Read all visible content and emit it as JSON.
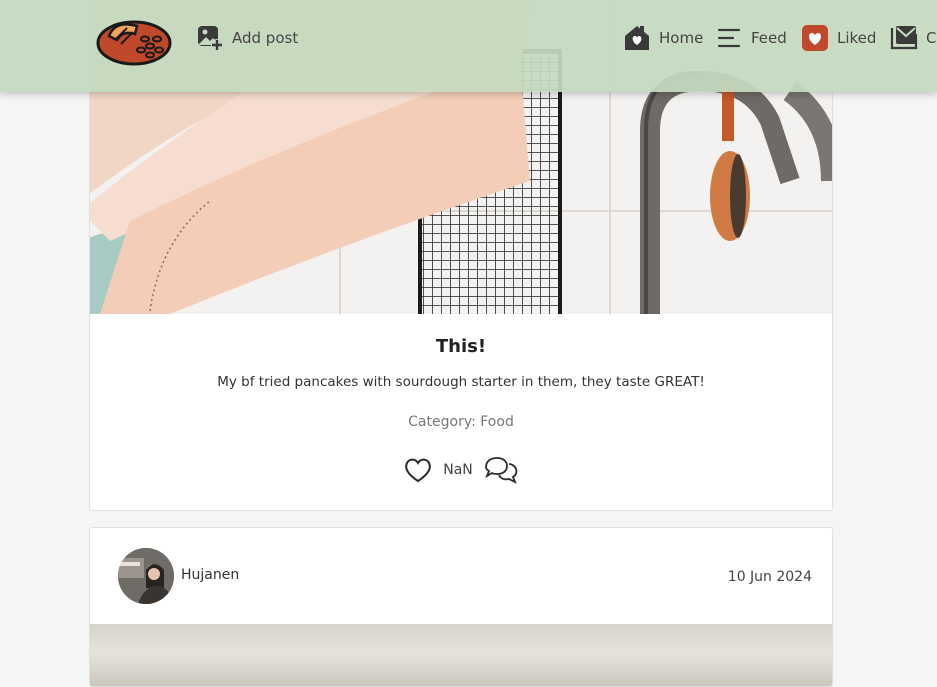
{
  "nav": {
    "add_post": "Add post",
    "home": "Home",
    "feed": "Feed",
    "liked": "Liked",
    "contact": "Co"
  },
  "posts": [
    {
      "title": "This!",
      "text": "My bf tried pancakes with sourdough starter in them, they taste GREAT!",
      "category": "Category: Food",
      "likes": "NaN"
    },
    {
      "author": "Hujanen",
      "date": "10 Jun 2024"
    }
  ],
  "colors": {
    "navbar": "#c4dac0",
    "accent": "#c0492b",
    "icon": "#3a3a3a"
  },
  "icons": [
    "bread-logo",
    "add-image-icon",
    "home-icon",
    "feed-icon",
    "heart-icon",
    "mail-icon",
    "comment-icon"
  ]
}
